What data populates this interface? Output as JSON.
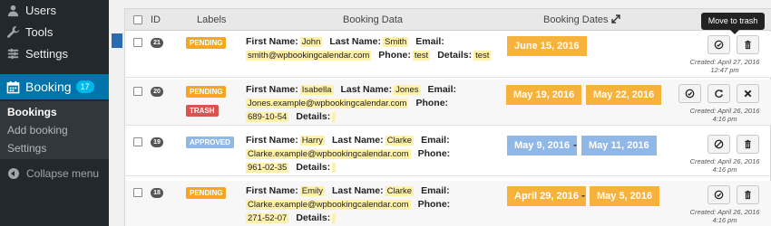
{
  "sidebar": {
    "items": [
      {
        "label": "Users",
        "icon": "users-icon"
      },
      {
        "label": "Tools",
        "icon": "wrench-icon"
      },
      {
        "label": "Settings",
        "icon": "settings-icon"
      }
    ],
    "booking": {
      "label": "Booking",
      "count": "17",
      "icon": "calendar-icon"
    },
    "submenu": [
      {
        "label": "Bookings"
      },
      {
        "label": "Add booking"
      },
      {
        "label": "Settings"
      }
    ],
    "collapse_label": "Collapse menu"
  },
  "table": {
    "headers": {
      "id": "ID",
      "labels": "Labels",
      "booking_data": "Booking Data",
      "booking_dates": "Booking Dates"
    },
    "rows": [
      {
        "id": "21",
        "labels": [
          "PENDING"
        ],
        "first_name": "John",
        "last_name": "Smith",
        "email": "smith@wpbookingcalendar.com",
        "phone": "test",
        "details": "test",
        "dates": [
          "June 15, 2016"
        ],
        "created_line1": "Created: April 27, 2016",
        "created_line2": "12:47 pm"
      },
      {
        "id": "20",
        "labels": [
          "PENDING",
          "TRASH"
        ],
        "first_name": "Isabella",
        "last_name": "Jones",
        "email": "Jones.example@wpbookingcalendar.com",
        "phone": "689-10-54",
        "details": "",
        "dates": [
          "May 19, 2016",
          "May 22, 2016"
        ],
        "created_line1": "Created: April 26, 2016",
        "created_line2": "4:16 pm"
      },
      {
        "id": "19",
        "labels": [
          "APPROVED"
        ],
        "first_name": "Harry",
        "last_name": "Clarke",
        "email": "Clarke.example@wpbookingcalendar.com",
        "phone": "961-02-35",
        "details": "",
        "dates": [
          "May 9, 2016",
          "May 11, 2016"
        ],
        "created_line1": "Created: April 26, 2016",
        "created_line2": "4:16 pm"
      },
      {
        "id": "18",
        "labels": [
          "PENDING"
        ],
        "first_name": "Emily",
        "last_name": "Clarke",
        "email": "Clarke.example@wpbookingcalendar.com",
        "phone": "271-52-07",
        "details": "",
        "dates": [
          "April 29, 2016",
          "May 5, 2016"
        ],
        "created_line1": "Created: April 26, 2016",
        "created_line2": "4:16 pm"
      }
    ],
    "field_labels": {
      "first": "First Name:",
      "last": "Last Name:",
      "email": "Email:",
      "phone": "Phone:",
      "details": "Details:"
    },
    "date_separator": "-"
  },
  "tooltip": "Move to trash",
  "colors": {
    "sidebar_bg": "#23282d",
    "active_menu": "#0073aa",
    "pending": "#f5a623",
    "trash": "#d9534f",
    "approved": "#8fb8e8",
    "date_orange": "#f7b23b",
    "date_blue": "#8fb8e8"
  }
}
